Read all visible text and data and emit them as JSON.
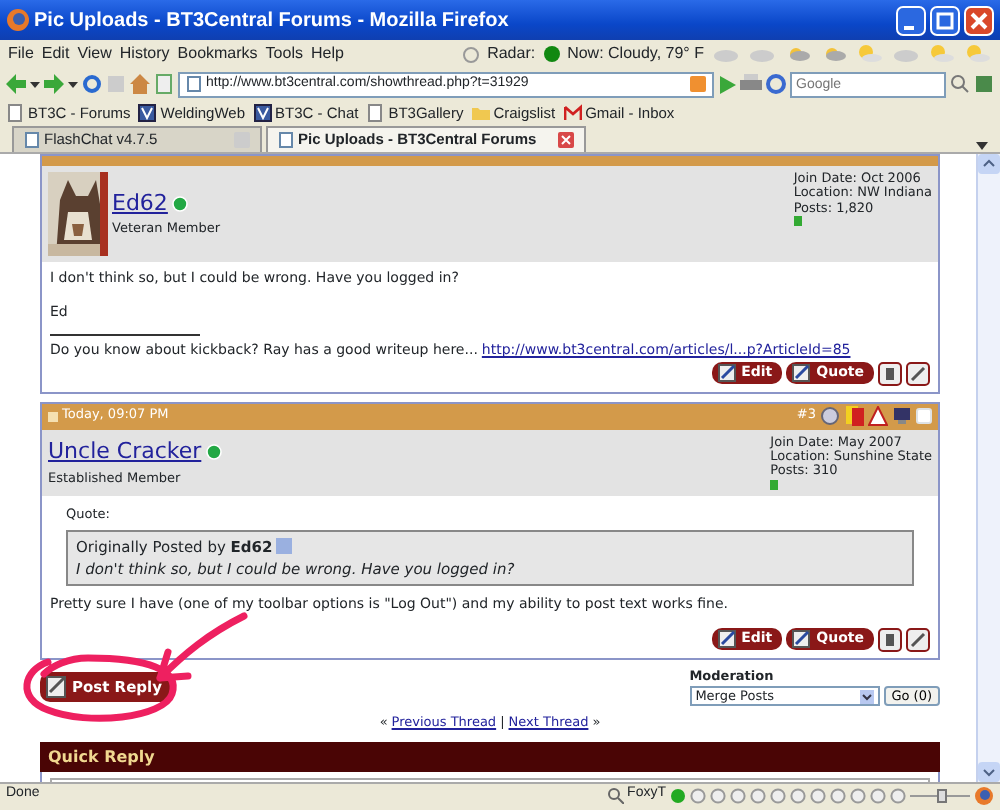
{
  "window": {
    "title": "Pic Uploads - BT3Central Forums - Mozilla Firefox"
  },
  "menu": [
    "File",
    "Edit",
    "View",
    "History",
    "Bookmarks",
    "Tools",
    "Help"
  ],
  "weather": {
    "radar_label": "Radar:",
    "now": "Now: Cloudy, 79° F"
  },
  "address": {
    "value": "http://www.bt3central.com/showthread.php?t=31929"
  },
  "search": {
    "placeholder": "Google"
  },
  "bookmarks": [
    {
      "label": "BT3C - Forums",
      "kind": "page"
    },
    {
      "label": "WeldingWeb",
      "kind": "site"
    },
    {
      "label": "BT3C - Chat",
      "kind": "site"
    },
    {
      "label": "BT3Gallery",
      "kind": "page"
    },
    {
      "label": "Craigslist",
      "kind": "folder"
    },
    {
      "label": "Gmail - Inbox",
      "kind": "mail"
    }
  ],
  "tabs": [
    {
      "label": "FlashChat v4.7.5",
      "selected": false
    },
    {
      "label": "Pic Uploads - BT3Central Forums",
      "selected": true
    }
  ],
  "posts": [
    {
      "username": "Ed62",
      "online": true,
      "user_title": "Veteran Member",
      "join": "Join Date: Oct 2006",
      "location": "Location: NW Indiana",
      "post_count": "Posts: 1,820",
      "paragraphs": [
        "I don't think so, but I could be wrong. Have you logged in?",
        "Ed"
      ],
      "signature": {
        "text": "Do you know about kickback? Ray has a good writeup here...",
        "link": "http://www.bt3central.com/articles/l...p?ArticleId=85"
      },
      "buttons": [
        "Edit",
        "Quote"
      ]
    },
    {
      "date": "Today, 09:07 PM",
      "number": "#3",
      "checked": false,
      "username": "Uncle Cracker",
      "online": true,
      "user_title": "Established Member",
      "join": "Join Date: May 2007",
      "location": "Location: Sunshine State",
      "post_count": "Posts: 310",
      "quote": {
        "label": "Quote:",
        "by": "Originally Posted by **Ed62**",
        "text": "I don't think so, but I could be wrong. Have you logged in?"
      },
      "paragraphs": [
        "Pretty sure I have (one of my toolbar options is \"Log Out\") and my ability to post text works fine."
      ],
      "buttons": [
        "Edit",
        "Quote"
      ]
    }
  ],
  "post_reply": "Post Reply",
  "moderation": {
    "label": "Moderation",
    "value": "Merge Posts",
    "go": "Go (0)"
  },
  "thread_nav": {
    "prev_mark": "«",
    "prev": "Previous Thread",
    "separator": "|",
    "next": "Next Thread",
    "next_mark": "»"
  },
  "quick_reply": "Quick Reply",
  "status": {
    "text": "Done",
    "toolbar": "FoxyT"
  }
}
